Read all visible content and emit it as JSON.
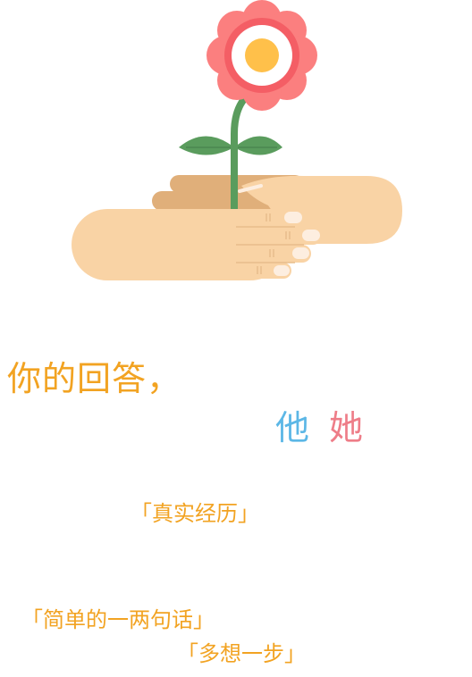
{
  "texts": {
    "headline": "你的回答，",
    "he": "他",
    "she": "她",
    "quote_real_experience": "「真实经历」",
    "quote_simple": "「简单的一两句话」",
    "quote_think_more": "「多想一步」"
  },
  "colors": {
    "accent_orange": "#f2a322",
    "blue": "#5cb7e6",
    "pink": "#ee7d88",
    "petal_outer": "#fb7f7f",
    "petal_inner": "#f45e65",
    "flower_center": "#ffc04a",
    "stem": "#5a9c5d",
    "skin_light": "#f9d3a5",
    "skin_dark": "#e0af7a",
    "nail": "#fdeee0"
  },
  "icons": {
    "illustration": "hands-holding-flower-icon"
  }
}
